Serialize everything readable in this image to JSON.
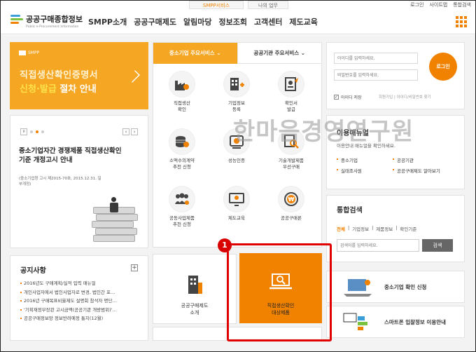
{
  "topbar": {
    "tab_smpp": "SMPP서비스",
    "tab_work": "나의 업무",
    "links": [
      "로그인",
      "사이트맵",
      "통합검색"
    ]
  },
  "header": {
    "logo_title": "공공구매종합정보",
    "logo_sub": "Public e-Procurement Information",
    "menu": [
      "SMPP소개",
      "공공구매제도",
      "알림마당",
      "정보조회",
      "고객센터",
      "제도교육"
    ]
  },
  "banner": {
    "tag": "SMPP",
    "line1": "직접생산확인증명서",
    "line2_highlight": "신청·발급",
    "line2_rest": " 절차 안내"
  },
  "notice_card": {
    "title": "중소기업자간 경쟁제품 직접생산확인기준 개정고시 안내",
    "sub": "(중소기업청 고시 제2015-70호, 2015.12.31. 일부개정)"
  },
  "board": {
    "title": "공지사항",
    "items": [
      "2016년도 구매계획/실적 입력 매뉴얼",
      "개인사업자에서 법인사업자로 변경, 법인간 포…",
      "2016년 구매목표비율제도 설명회 참석자 명단…",
      "'기획재정부장관 고시금액(공공기관 개방범위)'…",
      "공공구매정보망 정보반려예정 통지(12월)"
    ]
  },
  "services": {
    "tab_active": "중소기업 주요서비스",
    "tab_active_arrow": "⌄",
    "tab_inactive": "공공기관 주요서비스",
    "tab_inactive_arrow": "⌄",
    "items": [
      {
        "icon": "factory-icon",
        "label": "직접생산\n확인"
      },
      {
        "icon": "building-info-icon",
        "label": "기업정보\n등록"
      },
      {
        "icon": "certificate-icon",
        "label": "확인서\n발급"
      },
      {
        "icon": "coins-icon",
        "label": "소액수의계약\n추천 신청"
      },
      {
        "icon": "performance-cert-icon",
        "label": "성능인증"
      },
      {
        "icon": "tech-product-icon",
        "label": "기술개발제품\n우선구매"
      },
      {
        "icon": "group-icon",
        "label": "공동사업제품\n추천 신청"
      },
      {
        "icon": "education-icon",
        "label": "제도교육"
      },
      {
        "icon": "won-icon",
        "label": "공공구매론"
      }
    ]
  },
  "tile_left": {
    "icon": "public-building-icon",
    "label": "공공구매제도\n소개"
  },
  "tile_main": {
    "icon": "search-laptop-icon",
    "label": "직접생산확인\n대상제품"
  },
  "annotation": {
    "badge": "1"
  },
  "login": {
    "id_placeholder": "아이디를 입력하세요.",
    "pw_placeholder": "비밀번호를 입력하세요.",
    "button": "로그인",
    "save_id": "아이디 저장",
    "links": "회원가입 | 아이디/비밀번호 찾기"
  },
  "guide": {
    "title": "이용매뉴얼",
    "sub": "이용안내 매뉴얼을 확인하세요.",
    "items": [
      "중소기업",
      "공공기관",
      "실태조사원",
      "공공구매제도 알아보기"
    ]
  },
  "search": {
    "title": "통합검색",
    "categories": [
      "전체",
      "기업정보",
      "제품정보",
      "확인기준"
    ],
    "separator": "|",
    "placeholder": "검색어를 입력하세요.",
    "button": "검색"
  },
  "shortcuts": [
    {
      "label": "중소기업 확인 신청"
    },
    {
      "label": "스마트폰 입찰정보 이용안내"
    }
  ],
  "watermark": "한마음경영연구원",
  "colors": {
    "accent": "#f08200",
    "banner": "#f5a623",
    "annotation": "#e00000"
  }
}
